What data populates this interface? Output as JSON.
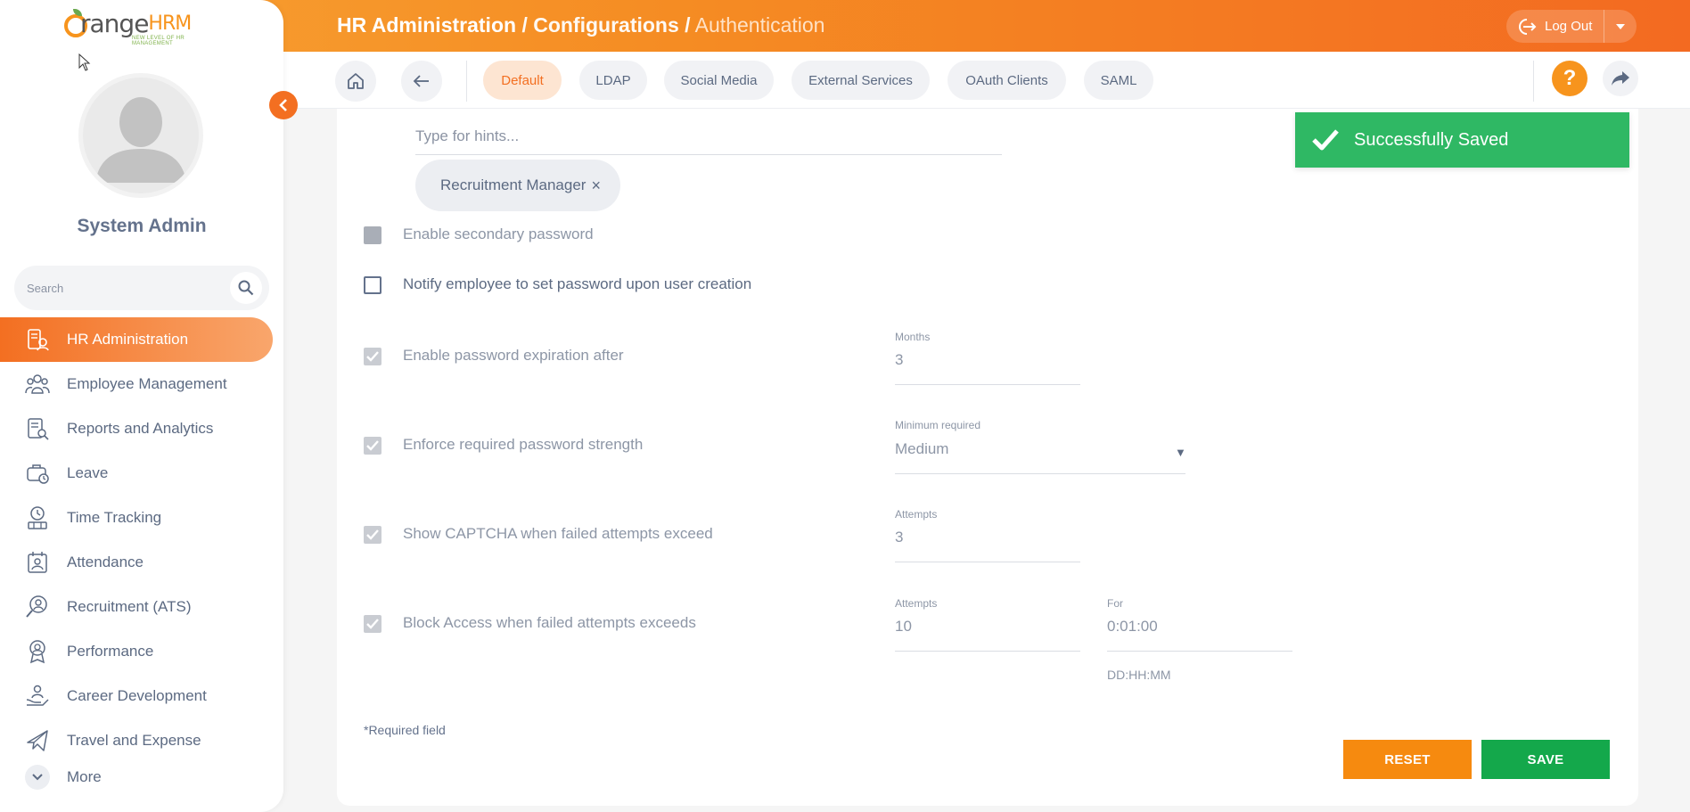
{
  "header": {
    "breadcrumb": [
      "HR Administration",
      "Configurations",
      "Authentication"
    ],
    "separator": "/",
    "logout_label": "Log Out"
  },
  "brand": {
    "name_a": "O",
    "name_b": "range",
    "name_c": "HRM",
    "tagline": "NEW LEVEL OF HR MANAGEMENT"
  },
  "user": {
    "name": "System Admin"
  },
  "search": {
    "placeholder": "Search"
  },
  "nav": {
    "items": [
      {
        "label": "HR Administration",
        "icon": "hr-admin-icon",
        "active": true
      },
      {
        "label": "Employee Management",
        "icon": "employees-icon"
      },
      {
        "label": "Reports and Analytics",
        "icon": "reports-icon"
      },
      {
        "label": "Leave",
        "icon": "leave-icon"
      },
      {
        "label": "Time Tracking",
        "icon": "time-icon"
      },
      {
        "label": "Attendance",
        "icon": "attendance-icon"
      },
      {
        "label": "Recruitment (ATS)",
        "icon": "recruitment-icon"
      },
      {
        "label": "Performance",
        "icon": "performance-icon"
      },
      {
        "label": "Career Development",
        "icon": "career-icon"
      },
      {
        "label": "Travel and Expense",
        "icon": "travel-icon"
      }
    ],
    "more_label": "More"
  },
  "tabs": [
    {
      "label": "Default",
      "active": true
    },
    {
      "label": "LDAP"
    },
    {
      "label": "Social Media"
    },
    {
      "label": "External Services"
    },
    {
      "label": "OAuth Clients"
    },
    {
      "label": "SAML"
    }
  ],
  "form": {
    "hint_placeholder": "Type for hints...",
    "chip_label": "Recruitment Manager",
    "chip_remove": "×",
    "rows": {
      "secondary_password": "Enable secondary password",
      "notify_employee": "Notify employee to set password upon user creation",
      "password_expiration": "Enable password expiration after",
      "password_strength": "Enforce required password strength",
      "captcha": "Show CAPTCHA when failed attempts exceed",
      "block_access": "Block Access when failed attempts exceeds"
    },
    "months_label": "Months",
    "months_value": "3",
    "strength_label": "Minimum required",
    "strength_value": "Medium",
    "captcha_label": "Attempts",
    "captcha_value": "3",
    "block_attempts_label": "Attempts",
    "block_attempts_value": "10",
    "block_for_label": "For",
    "block_for_value": "0:01:00",
    "block_for_hint": "DD:HH:MM",
    "required_note": "*Required field",
    "reset_label": "RESET",
    "save_label": "SAVE"
  },
  "toast": {
    "message": "Successfully Saved"
  },
  "colors": {
    "accent": "#f36f21",
    "save": "#14a84b",
    "reset": "#f68a0f",
    "toast": "#2fb864"
  }
}
